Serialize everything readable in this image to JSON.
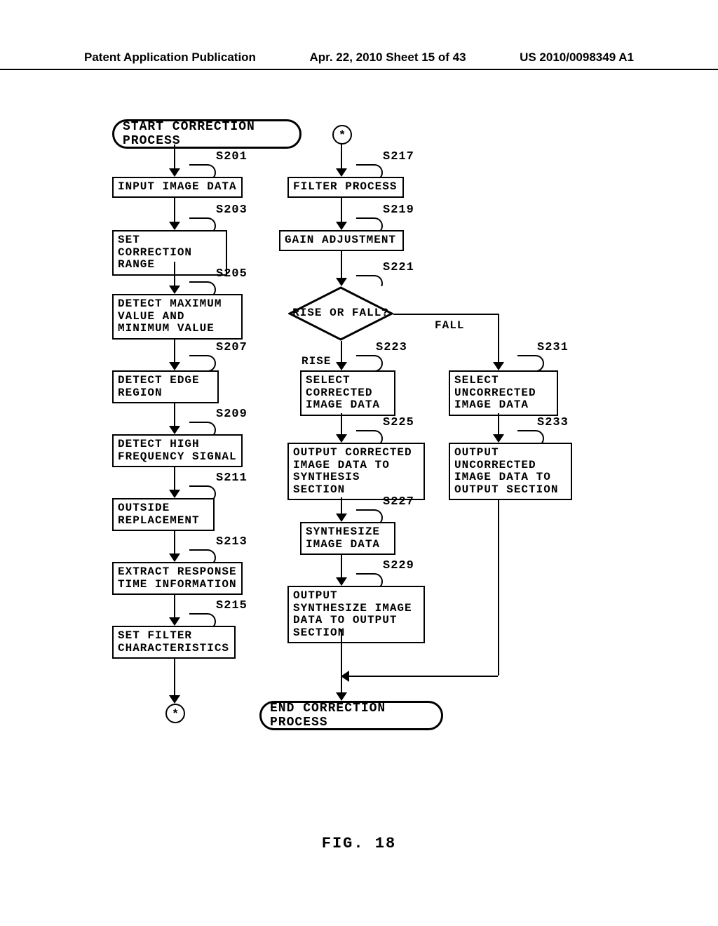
{
  "header": {
    "left": "Patent Application Publication",
    "center": "Apr. 22, 2010  Sheet 15 of 43",
    "right": "US 2010/0098349 A1"
  },
  "figure_label": "FIG. 18",
  "flowchart": {
    "start": "START CORRECTION PROCESS",
    "end": "END CORRECTION PROCESS",
    "connector_symbol": "*",
    "decision": {
      "text": "RISE OR FALL?",
      "rise_label": "RISE",
      "fall_label": "FALL"
    },
    "steps": {
      "s201": {
        "label": "S201",
        "text": "INPUT IMAGE DATA"
      },
      "s203": {
        "label": "S203",
        "text": "SET CORRECTION RANGE"
      },
      "s205": {
        "label": "S205",
        "text": "DETECT MAXIMUM VALUE AND MINIMUM VALUE"
      },
      "s207": {
        "label": "S207",
        "text": "DETECT EDGE REGION"
      },
      "s209": {
        "label": "S209",
        "text": "DETECT HIGH FREQUENCY SIGNAL"
      },
      "s211": {
        "label": "S211",
        "text": "OUTSIDE REPLACEMENT"
      },
      "s213": {
        "label": "S213",
        "text": "EXTRACT RESPONSE TIME INFORMATION"
      },
      "s215": {
        "label": "S215",
        "text": "SET FILTER CHARACTERISTICS"
      },
      "s217": {
        "label": "S217",
        "text": "FILTER PROCESS"
      },
      "s219": {
        "label": "S219",
        "text": "GAIN ADJUSTMENT"
      },
      "s221": {
        "label": "S221"
      },
      "s223": {
        "label": "S223",
        "text": "SELECT CORRECTED IMAGE DATA"
      },
      "s225": {
        "label": "S225",
        "text": "OUTPUT CORRECTED IMAGE DATA TO SYNTHESIS SECTION"
      },
      "s227": {
        "label": "S227",
        "text": "SYNTHESIZE IMAGE DATA"
      },
      "s229": {
        "label": "S229",
        "text": "OUTPUT SYNTHESIZE IMAGE DATA TO OUTPUT SECTION"
      },
      "s231": {
        "label": "S231",
        "text": "SELECT UNCORRECTED IMAGE DATA"
      },
      "s233": {
        "label": "S233",
        "text": "OUTPUT UNCORRECTED IMAGE DATA TO OUTPUT SECTION"
      }
    }
  }
}
